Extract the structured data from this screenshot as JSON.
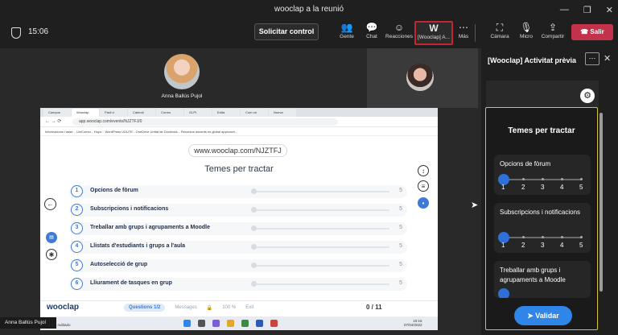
{
  "window": {
    "title": "wooclap a la reunió",
    "controls": [
      "—",
      "❐",
      "✕"
    ]
  },
  "toolbar": {
    "timer": "15:06",
    "control_label": "Solicitar control",
    "buttons": [
      {
        "label": "Gente",
        "icon": "people-icon"
      },
      {
        "label": "Chat",
        "icon": "chat-icon"
      },
      {
        "label": "Reacciones",
        "icon": "reactions-icon"
      },
      {
        "label": "[Wooclap] A...",
        "icon": "wooclap-icon"
      },
      {
        "label": "Más",
        "icon": "more-icon"
      },
      {
        "label": "Cámara",
        "icon": "camera-icon"
      },
      {
        "label": "Micro",
        "icon": "mic-icon"
      },
      {
        "label": "Compartir",
        "icon": "share-icon"
      }
    ],
    "leave_label": "Salir"
  },
  "participants": {
    "speaker_name": "Anna Ballús Pujol",
    "presenter_name": "Anna Ballús Pujol"
  },
  "shared_screen": {
    "tabs": [
      "Campus",
      "Wooclap",
      "Fàcil d",
      "Calendi",
      "Correu",
      "GLPI",
      "Edita",
      "Com ori",
      "Nueva"
    ],
    "url": "app.wooclap.com/events/NJZTFJ/0",
    "bookmarks": "Informacions i asse...   UniCorreo - Hoyo...   WordPress   UDUTE - OneDrive   Unitat de Docència...   Recursos docents   es global approach...",
    "code": "www.wooclap.com/NJZTFJ",
    "question_title": "Temes per tractar",
    "items": [
      {
        "num": "1",
        "text": "Opcions de fòrum",
        "max": "5"
      },
      {
        "num": "2",
        "text": "Subscripcions i notificacions",
        "max": "5"
      },
      {
        "num": "3",
        "text": "Treballar amb grups i agrupaments a Moodle",
        "max": "5"
      },
      {
        "num": "4",
        "text": "Llistats d'estudiants i grups a l'aula",
        "max": "5"
      },
      {
        "num": "5",
        "text": "Autoselecció de grup",
        "max": "5"
      },
      {
        "num": "6",
        "text": "Lliurament de tasques en grup",
        "max": "5"
      }
    ],
    "logo": "wooclap",
    "footer": {
      "questions_label": "Questions",
      "page_current": "1",
      "page_total": "2",
      "messages_label": "Messages",
      "zoom": "100 %",
      "exit_label": "Exit",
      "counter": "0 / 11"
    },
    "taskbar": {
      "weather_temp": "7°C",
      "weather_desc": "Majorm. nublado",
      "time": "10:16",
      "date": "07/04/2022"
    }
  },
  "panel": {
    "title": "[Wooclap] Activitat prèvia",
    "vote_title": "Temes per tractar",
    "cards": [
      {
        "text": "Opcions de fòrum",
        "scale": [
          "1",
          "2",
          "3",
          "4",
          "5"
        ]
      },
      {
        "text": "Subscripcions i notificacions",
        "scale": [
          "1",
          "2",
          "3",
          "4",
          "5"
        ]
      },
      {
        "text": "Treballar amb grups i agrupaments a Moodle",
        "scale": []
      }
    ],
    "submit_label": "Validar"
  },
  "colors": {
    "accent_blue": "#2f86e8",
    "leave_red": "#c4314b",
    "highlight_yellow": "#ccc23c",
    "wooclap_border": "#c2262e"
  }
}
